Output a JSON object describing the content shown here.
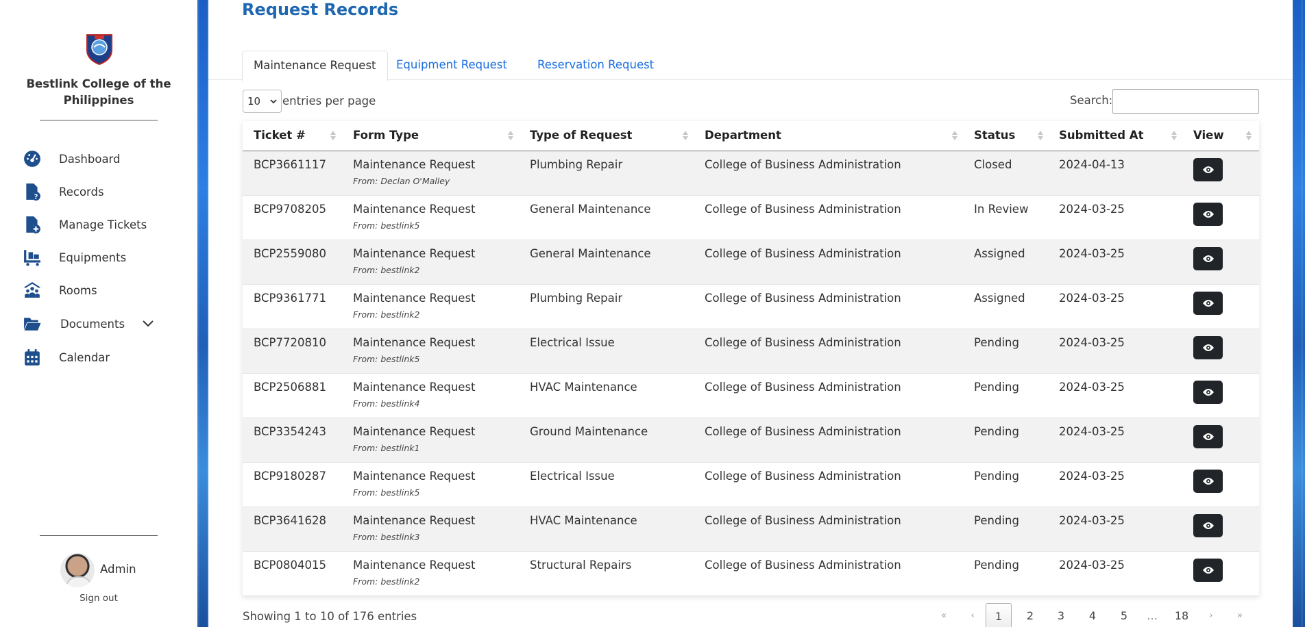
{
  "sidebar": {
    "brand": "Bestlink College of the Philippines",
    "nav": [
      {
        "label": "Dashboard",
        "icon": "dashboard-icon"
      },
      {
        "label": "Records",
        "icon": "records-icon"
      },
      {
        "label": "Manage Tickets",
        "icon": "manage-tickets-icon"
      },
      {
        "label": "Equipments",
        "icon": "equipment-cart-icon"
      },
      {
        "label": "Rooms",
        "icon": "rooms-people-icon"
      },
      {
        "label": "Documents",
        "icon": "folder-icon"
      },
      {
        "label": "Calendar",
        "icon": "calendar-icon"
      }
    ],
    "user": {
      "name": "Admin",
      "signout": "Sign out"
    }
  },
  "main": {
    "title": "Request Records",
    "tabs": [
      "Maintenance Request",
      "Equipment Request",
      "Reservation Request"
    ],
    "active_tab": 0,
    "length_select": {
      "value": "10",
      "label": "entries per page"
    },
    "search": {
      "label": "Search:",
      "value": ""
    },
    "columns": [
      "Ticket #",
      "Form Type",
      "Type of Request",
      "Department",
      "Status",
      "Submitted At",
      "View"
    ],
    "rows": [
      {
        "ticket": "BCP3661117",
        "form": "Maintenance Request",
        "from": "From: Declan O'Malley",
        "type": "Plumbing Repair",
        "department": "College of Business Administration",
        "status": "Closed",
        "submitted": "2024-04-13"
      },
      {
        "ticket": "BCP9708205",
        "form": "Maintenance Request",
        "from": "From: bestlink5",
        "type": "General Maintenance",
        "department": "College of Business Administration",
        "status": "In Review",
        "submitted": "2024-03-25"
      },
      {
        "ticket": "BCP2559080",
        "form": "Maintenance Request",
        "from": "From: bestlink2",
        "type": "General Maintenance",
        "department": "College of Business Administration",
        "status": "Assigned",
        "submitted": "2024-03-25"
      },
      {
        "ticket": "BCP9361771",
        "form": "Maintenance Request",
        "from": "From: bestlink2",
        "type": "Plumbing Repair",
        "department": "College of Business Administration",
        "status": "Assigned",
        "submitted": "2024-03-25"
      },
      {
        "ticket": "BCP7720810",
        "form": "Maintenance Request",
        "from": "From: bestlink5",
        "type": "Electrical Issue",
        "department": "College of Business Administration",
        "status": "Pending",
        "submitted": "2024-03-25"
      },
      {
        "ticket": "BCP2506881",
        "form": "Maintenance Request",
        "from": "From: bestlink4",
        "type": "HVAC Maintenance",
        "department": "College of Business Administration",
        "status": "Pending",
        "submitted": "2024-03-25"
      },
      {
        "ticket": "BCP3354243",
        "form": "Maintenance Request",
        "from": "From: bestlink1",
        "type": "Ground Maintenance",
        "department": "College of Business Administration",
        "status": "Pending",
        "submitted": "2024-03-25"
      },
      {
        "ticket": "BCP9180287",
        "form": "Maintenance Request",
        "from": "From: bestlink5",
        "type": "Electrical Issue",
        "department": "College of Business Administration",
        "status": "Pending",
        "submitted": "2024-03-25"
      },
      {
        "ticket": "BCP3641628",
        "form": "Maintenance Request",
        "from": "From: bestlink3",
        "type": "HVAC Maintenance",
        "department": "College of Business Administration",
        "status": "Pending",
        "submitted": "2024-03-25"
      },
      {
        "ticket": "BCP0804015",
        "form": "Maintenance Request",
        "from": "From: bestlink2",
        "type": "Structural Repairs",
        "department": "College of Business Administration",
        "status": "Pending",
        "submitted": "2024-03-25"
      }
    ],
    "info": "Showing 1 to 10 of 176 entries",
    "pagination": {
      "first": "«",
      "prev": "‹",
      "next": "›",
      "last": "»",
      "pages": [
        "1",
        "2",
        "3",
        "4",
        "5",
        "…",
        "18"
      ],
      "current": "1"
    }
  },
  "colors": {
    "accent": "#1f67b0",
    "link": "#1a6fe0",
    "nav_icon": "#1f4e8c",
    "view_button": "#212529"
  }
}
